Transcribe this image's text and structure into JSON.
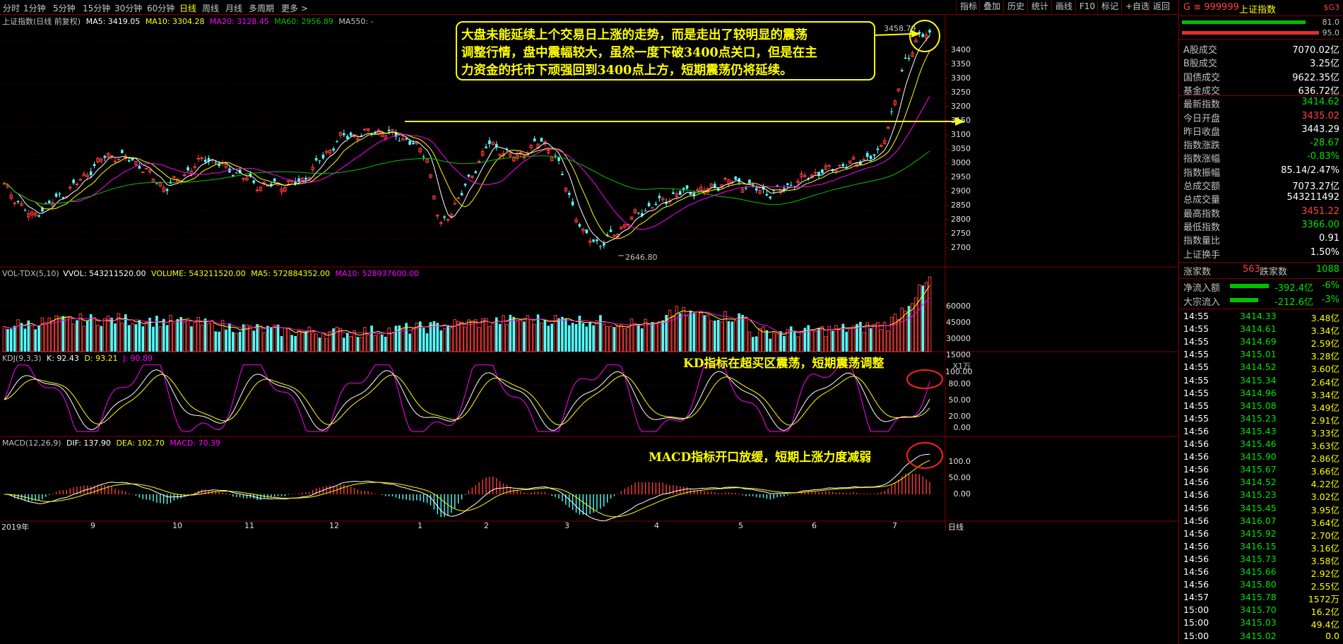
{
  "toolbar": {
    "periods": [
      "分时",
      "1分钟",
      "5分钟",
      "15分钟",
      "30分钟",
      "60分钟",
      "日线",
      "周线",
      "月线",
      "多周期",
      "更多 >"
    ],
    "active_period": "日线",
    "buttons": [
      "指标",
      "叠加",
      "历史",
      "统计",
      "画线",
      "F10",
      "标记",
      "+自选",
      "返回"
    ]
  },
  "main_chart": {
    "title": "上证指数(日线 前复权)",
    "ma_labels": [
      "MA5: 3419.05",
      "MA10: 3304.28",
      "MA20: 3128.45",
      "MA60: 2956.89",
      "MA550: -"
    ],
    "ma_colors": [
      "#ffffff",
      "#ffff00",
      "#ff00ff",
      "#00c000",
      "#c0c0c0"
    ],
    "high_label": "3458.79",
    "low_label": "2646.80",
    "price_ticks": [
      "3400",
      "3350",
      "3300",
      "3250",
      "3200",
      "3150",
      "3100",
      "3050",
      "3000",
      "2950",
      "2900",
      "2850",
      "2800",
      "2750",
      "2700"
    ],
    "annotation": [
      "大盘未能延续上个交易日上涨的走势，而是走出了较明显的震荡",
      "调整行情，盘中震幅较大，虽然一度下破3400点关口，但是在主",
      "力资金的托市下顽强回到3400点上方，短期震荡仍将延续。"
    ]
  },
  "volume_chart": {
    "labels": [
      "VOL-TDX(5,10)",
      "VVOL: 543211520.00",
      "VOLUME: 543211520.00",
      "MA5: 572884352.00",
      "MA10: 528937600.00"
    ],
    "label_colors": [
      "#c0c0c0",
      "#ffffff",
      "#ffff00",
      "#ffff00",
      "#ff00ff"
    ],
    "ticks": [
      "60000",
      "45000",
      "30000",
      "15000"
    ],
    "unit": "X1万"
  },
  "kdj_chart": {
    "labels": [
      "KDJ(9,3,3)",
      "K: 92.43",
      "D: 93.21",
      "J: 90.89"
    ],
    "label_colors": [
      "#c0c0c0",
      "#ffffff",
      "#ffff00",
      "#ff00ff"
    ],
    "ticks": [
      "100.00",
      "80.00",
      "50.00",
      "20.00",
      "0.00"
    ],
    "annotation": "KD指标在超买区震荡，短期震荡调整"
  },
  "macd_chart": {
    "labels": [
      "MACD(12,26,9)",
      "DIF: 137.90",
      "DEA: 102.70",
      "MACD: 70.39"
    ],
    "label_colors": [
      "#c0c0c0",
      "#ffffff",
      "#ffff00",
      "#ff00ff"
    ],
    "ticks": [
      "100.0",
      "50.00",
      "0.00"
    ],
    "annotation": "MACD指标开口放缓，短期上涨力度减弱"
  },
  "xaxis": {
    "labels": [
      "2019年",
      "9",
      "10",
      "11",
      "12",
      "1",
      "2",
      "3",
      "4",
      "5",
      "6",
      "7"
    ],
    "right_label": "日线"
  },
  "panel": {
    "header_code": "G ≡ 999999",
    "header_name": "上证指数",
    "header_tag": "$G3",
    "bar_values": [
      "81.0",
      "95.0"
    ],
    "stats": [
      {
        "label": "A股成交",
        "value": "7070.02亿",
        "color": "white"
      },
      {
        "label": "B股成交",
        "value": "3.25亿",
        "color": "white"
      },
      {
        "label": "国债成交",
        "value": "9622.35亿",
        "color": "white"
      },
      {
        "label": "基金成交",
        "value": "636.72亿",
        "color": "white"
      },
      {
        "label": "最新指数",
        "value": "3414.62",
        "color": "green"
      },
      {
        "label": "今日开盘",
        "value": "3435.02",
        "color": "red"
      },
      {
        "label": "昨日收盘",
        "value": "3443.29",
        "color": "white"
      },
      {
        "label": "指数涨跌",
        "value": "-28.67",
        "color": "green"
      },
      {
        "label": "指数涨幅",
        "value": "-0.83%",
        "color": "green"
      },
      {
        "label": "指数振幅",
        "value": "85.14/2.47%",
        "color": "white"
      },
      {
        "label": "总成交额",
        "value": "7073.27亿",
        "color": "white"
      },
      {
        "label": "总成交量",
        "value": "543211492",
        "color": "white"
      },
      {
        "label": "最高指数",
        "value": "3451.22",
        "color": "red"
      },
      {
        "label": "最低指数",
        "value": "3366.00",
        "color": "green"
      },
      {
        "label": "指数量比",
        "value": "0.91",
        "color": "white"
      },
      {
        "label": "上证换手",
        "value": "1.50%",
        "color": "white"
      }
    ],
    "rise_label": "涨家数",
    "rise_count": "563",
    "fall_label": "跌家数",
    "fall_count": "1088",
    "flows": [
      {
        "label": "净流入额",
        "amount": "-392.4亿",
        "pct": "-6%"
      },
      {
        "label": "大宗流入",
        "amount": "-212.6亿",
        "pct": "-3%"
      }
    ],
    "ticks": [
      [
        "14:55",
        "3414.33",
        "3.48亿"
      ],
      [
        "14:55",
        "3414.61",
        "3.34亿"
      ],
      [
        "14:55",
        "3414.69",
        "2.59亿"
      ],
      [
        "14:55",
        "3415.01",
        "3.28亿"
      ],
      [
        "14:55",
        "3414.52",
        "3.60亿"
      ],
      [
        "14:55",
        "3415.34",
        "2.64亿"
      ],
      [
        "14:55",
        "3414.96",
        "3.34亿"
      ],
      [
        "14:55",
        "3415.08",
        "3.49亿"
      ],
      [
        "14:55",
        "3415.23",
        "2.91亿"
      ],
      [
        "14:56",
        "3415.43",
        "3.33亿"
      ],
      [
        "14:56",
        "3415.46",
        "3.63亿"
      ],
      [
        "14:56",
        "3415.90",
        "2.86亿"
      ],
      [
        "14:56",
        "3415.67",
        "3.66亿"
      ],
      [
        "14:56",
        "3414.52",
        "4.22亿"
      ],
      [
        "14:56",
        "3415.23",
        "3.02亿"
      ],
      [
        "14:56",
        "3415.45",
        "3.95亿"
      ],
      [
        "14:56",
        "3416.07",
        "3.64亿"
      ],
      [
        "14:56",
        "3415.92",
        "2.70亿"
      ],
      [
        "14:56",
        "3416.15",
        "3.16亿"
      ],
      [
        "14:56",
        "3415.73",
        "3.58亿"
      ],
      [
        "14:56",
        "3415.66",
        "2.92亿"
      ],
      [
        "14:56",
        "3415.80",
        "2.55亿"
      ],
      [
        "14:57",
        "3415.78",
        "1572万"
      ],
      [
        "15:00",
        "3415.70",
        "16.2亿"
      ],
      [
        "15:00",
        "3415.03",
        "49.4亿"
      ],
      [
        "15:00",
        "3415.02",
        "0.0"
      ]
    ]
  }
}
